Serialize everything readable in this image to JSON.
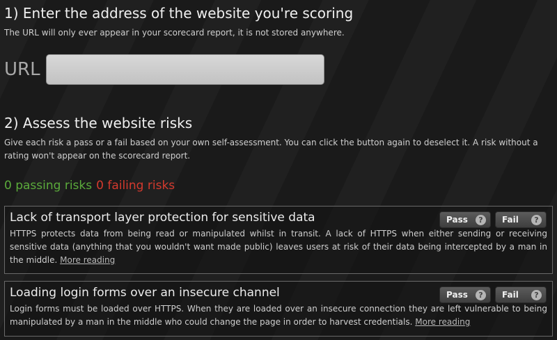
{
  "step1": {
    "heading": "1) Enter the address of the website you're scoring",
    "description": "The URL will only ever appear in your scorecard report, it is not stored anywhere.",
    "url_label": "URL",
    "url_value": ""
  },
  "step2": {
    "heading": "2) Assess the website risks",
    "description": "Give each risk a pass or a fail based on your own self-assessment. You can click the button again to deselect it. A risk without a rating won't appear on the scorecard report."
  },
  "counts": {
    "passing": "0 passing risks",
    "failing": "0 failing risks",
    "passing_color": "#5bab3b",
    "failing_color": "#d43a2e"
  },
  "risks": [
    {
      "title": "Lack of transport layer protection for sensitive data",
      "text": "HTTPS protects data from being read or manipulated whilst in transit. A lack of HTTPS when either sending or receiving sensitive data (anything that you wouldn't want made public) leaves users at risk of their data being intercepted by a man in the middle.",
      "more_link": "More reading",
      "pass_label": "Pass",
      "fail_label": "Fail",
      "help_glyph": "?"
    },
    {
      "title": "Loading login forms over an insecure channel",
      "text": "Login forms must be loaded over HTTPS. When they are loaded over an insecure connection they are left vulnerable to being manipulated by a man in the middle who could change the page in order to harvest credentials.",
      "more_link": "More reading",
      "pass_label": "Pass",
      "fail_label": "Fail",
      "help_glyph": "?"
    }
  ]
}
